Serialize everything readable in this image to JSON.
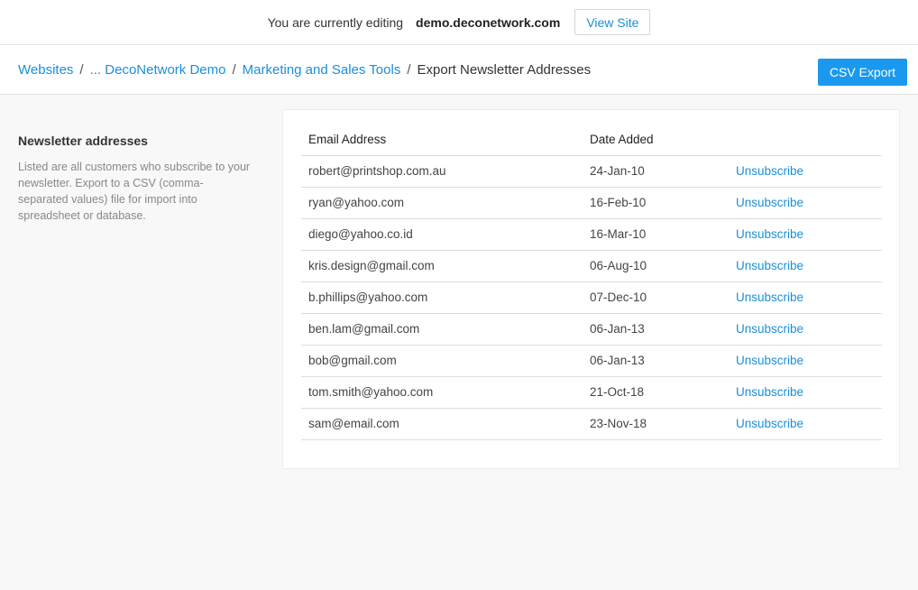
{
  "topbar": {
    "prefix": "You are currently editing",
    "domain": "demo.deconetwork.com",
    "view_site": "View Site"
  },
  "breadcrumb": {
    "items": [
      "Websites",
      "... DecoNetwork Demo",
      "Marketing and Sales Tools"
    ],
    "separator": "/",
    "current": "Export Newsletter Addresses"
  },
  "actions": {
    "csv_export": "CSV Export"
  },
  "sidebar": {
    "title": "Newsletter addresses",
    "description": "Listed are all customers who subscribe to your newsletter. Export to a CSV (comma-separated values) file for import into spreadsheet or database."
  },
  "table": {
    "columns": [
      "Email Address",
      "Date Added",
      ""
    ],
    "action_label": "Unsubscribe",
    "rows": [
      {
        "email": "robert@printshop.com.au",
        "date": "24-Jan-10"
      },
      {
        "email": "ryan@yahoo.com",
        "date": "16-Feb-10"
      },
      {
        "email": "diego@yahoo.co.id",
        "date": "16-Mar-10"
      },
      {
        "email": "kris.design@gmail.com",
        "date": "06-Aug-10"
      },
      {
        "email": "b.phillips@yahoo.com",
        "date": "07-Dec-10"
      },
      {
        "email": "ben.lam@gmail.com",
        "date": "06-Jan-13"
      },
      {
        "email": "bob@gmail.com",
        "date": "06-Jan-13"
      },
      {
        "email": "tom.smith@yahoo.com",
        "date": "21-Oct-18"
      },
      {
        "email": "sam@email.com",
        "date": "23-Nov-18"
      }
    ]
  },
  "colors": {
    "link": "#1a8fd8",
    "primary_button": "#1a99ee"
  }
}
